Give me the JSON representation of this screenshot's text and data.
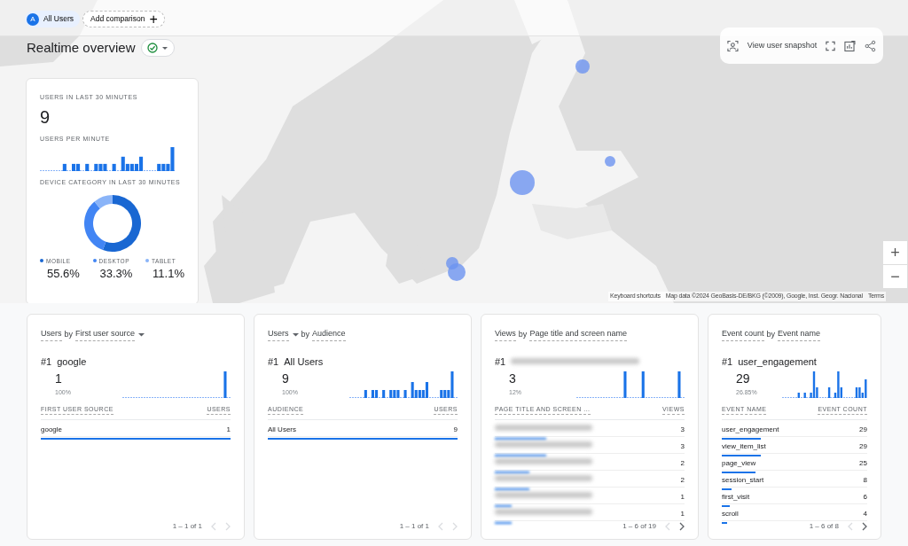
{
  "comparison_bar": {
    "audience_chip": {
      "avatar": "A",
      "label": "All Users"
    },
    "add_button": {
      "label": "Add comparison",
      "icon": "+"
    }
  },
  "header": {
    "title": "Realtime overview",
    "status_ok": true
  },
  "snapshot_toolbar": {
    "label": "View user snapshot"
  },
  "map": {
    "kind": "picture",
    "zoom_in": "+",
    "zoom_out": "−",
    "attribution": [
      "Keyboard shortcuts",
      "Map data ©2024 GeoBasis-DE/BKG (©2009), Google, Inst. Geogr. Nacional",
      "Terms"
    ]
  },
  "summary_card": {
    "users_label": "USERS IN LAST 30 MINUTES",
    "users_value": "9",
    "per_minute_label": "USERS PER MINUTE",
    "device_label": "DEVICE CATEGORY IN LAST 30 MINUTES",
    "chart_data": {
      "type": "donut",
      "categories": [
        "MOBILE",
        "DESKTOP",
        "TABLET"
      ],
      "values": [
        55.6,
        33.3,
        11.1
      ]
    },
    "legend": [
      {
        "value": "55.6%",
        "color": "#1967d2"
      },
      {
        "value": "33.3%",
        "color": "#4285f4"
      },
      {
        "value": "11.1%",
        "color": "#8ab4f8"
      }
    ]
  },
  "cards": [
    {
      "title_parts": [
        {
          "text": "Users",
          "kind": "link",
          "dropdown": false
        },
        {
          "text": "by",
          "kind": "plain"
        },
        {
          "text": "First user source",
          "kind": "link",
          "dropdown": true
        }
      ],
      "rank": "#1",
      "top_name": "google",
      "top_value": "1",
      "top_share": "100%",
      "columns": [
        "FIRST USER SOURCE",
        "USERS"
      ],
      "rows": [
        {
          "kind": "text",
          "label": "google",
          "value": "1",
          "level": 1
        }
      ],
      "pager": "1 – 1 of 1",
      "prev_disabled": true,
      "next_disabled": true
    },
    {
      "title_parts": [
        {
          "text": "Users",
          "kind": "link",
          "dropdown": true
        },
        {
          "text": "by",
          "kind": "plain"
        },
        {
          "text": "Audience",
          "kind": "link",
          "dropdown": false
        }
      ],
      "rank": "#1",
      "top_name": "All Users",
      "top_value": "9",
      "top_share": "100%",
      "columns": [
        "AUDIENCE",
        "USERS"
      ],
      "rows": [
        {
          "kind": "text",
          "label": "All Users",
          "value": "9",
          "level": 1
        }
      ],
      "pager": "1 – 1 of 1",
      "prev_disabled": true,
      "next_disabled": true
    },
    {
      "title_parts": [
        {
          "text": "Views",
          "kind": "link",
          "dropdown": false
        },
        {
          "text": "by",
          "kind": "plain"
        },
        {
          "text": "Page title and screen name",
          "kind": "link",
          "dropdown": false
        }
      ],
      "rank": "#1",
      "top_value": "3",
      "top_share": "12%",
      "columns": [
        "PAGE TITLE AND SCREEN ...",
        "VIEWS"
      ],
      "rows": [
        {
          "kind": "blurred",
          "value": "3",
          "level": 0.27
        },
        {
          "kind": "blurred",
          "value": "3",
          "level": 0.27
        },
        {
          "kind": "blurred",
          "value": "2",
          "level": 0.18
        },
        {
          "kind": "blurred",
          "value": "2",
          "level": 0.18
        },
        {
          "kind": "blurred",
          "value": "1",
          "level": 0.09
        },
        {
          "kind": "blurred",
          "value": "1",
          "level": 0.09
        }
      ],
      "pager": "1 – 6 of 19",
      "prev_disabled": true,
      "next_disabled": false
    },
    {
      "title_parts": [
        {
          "text": "Event count",
          "kind": "link",
          "dropdown": false
        },
        {
          "text": "by",
          "kind": "plain"
        },
        {
          "text": "Event name",
          "kind": "link",
          "dropdown": false
        }
      ],
      "rank": "#1",
      "top_name": "user_engagement",
      "top_value": "29",
      "top_share": "26.85%",
      "columns": [
        "EVENT NAME",
        "EVENT COUNT"
      ],
      "rows": [
        {
          "kind": "text",
          "label": "user_engagement",
          "value": "29",
          "level": 0.27
        },
        {
          "kind": "text",
          "label": "view_item_list",
          "value": "29",
          "level": 0.27
        },
        {
          "kind": "text",
          "label": "page_view",
          "value": "25",
          "level": 0.23
        },
        {
          "kind": "text",
          "label": "session_start",
          "value": "8",
          "level": 0.07
        },
        {
          "kind": "text",
          "label": "first_visit",
          "value": "6",
          "level": 0.055
        },
        {
          "kind": "text",
          "label": "scroll",
          "value": "4",
          "level": 0.035
        }
      ],
      "pager": "1 – 6 of 8",
      "prev_disabled": true,
      "next_disabled": false
    }
  ]
}
